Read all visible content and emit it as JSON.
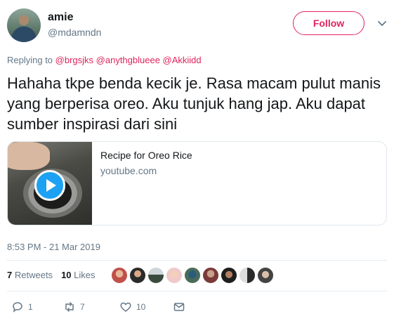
{
  "user": {
    "name": "amie",
    "handle": "@mdamndn",
    "follow_label": "Follow"
  },
  "reply": {
    "prefix": "Replying to",
    "mentions": "@brgsjks @anythgblueee @Akkiidd"
  },
  "tweet": {
    "text": "Hahaha tkpe benda kecik je. Rasa macam pulut manis yang berperisa oreo. Aku tunjuk hang jap. Aku dapat sumber inspirasi dari sini"
  },
  "card": {
    "title": "Recipe for Oreo Rice",
    "domain": "youtube.com",
    "thumbnail_icon": "play-icon"
  },
  "timestamp": "8:53 PM - 21 Mar 2019",
  "stats": {
    "retweets_count": "7",
    "retweets_label": "Retweets",
    "likes_count": "10",
    "likes_label": "Likes"
  },
  "actions": {
    "reply_count": "1",
    "retweet_count": "7",
    "like_count": "10"
  },
  "colors": {
    "accent": "#e0245e",
    "link_blue": "#1da1f2",
    "muted": "#657786"
  }
}
